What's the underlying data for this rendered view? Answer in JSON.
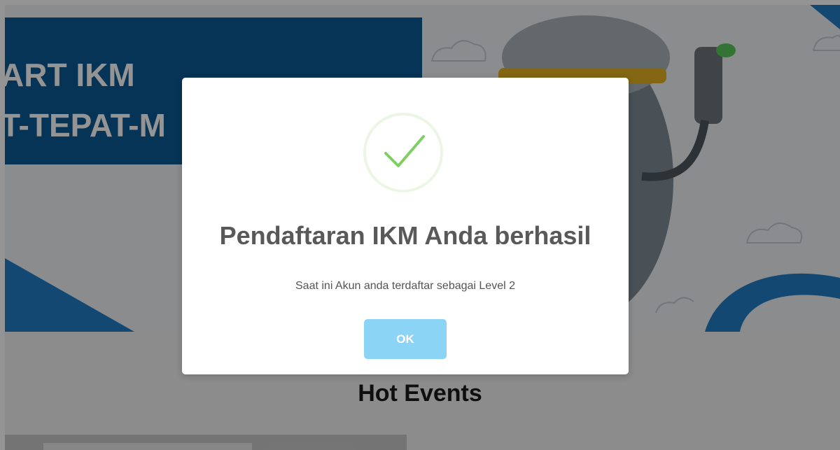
{
  "hero": {
    "line1": "ART IKM",
    "line2": "T-TEPAT-M"
  },
  "section": {
    "title": "Hot Events"
  },
  "modal": {
    "icon": "check-icon",
    "title": "Pendaftaran IKM Anda berhasil",
    "text": "Saat ini Akun anda terdaftar sebagai Level 2",
    "ok_label": "OK"
  },
  "colors": {
    "hero_blue": "#0b5a94",
    "success_green": "#a5dc86",
    "ok_button": "#8cd4f5",
    "title_text": "#595959"
  }
}
